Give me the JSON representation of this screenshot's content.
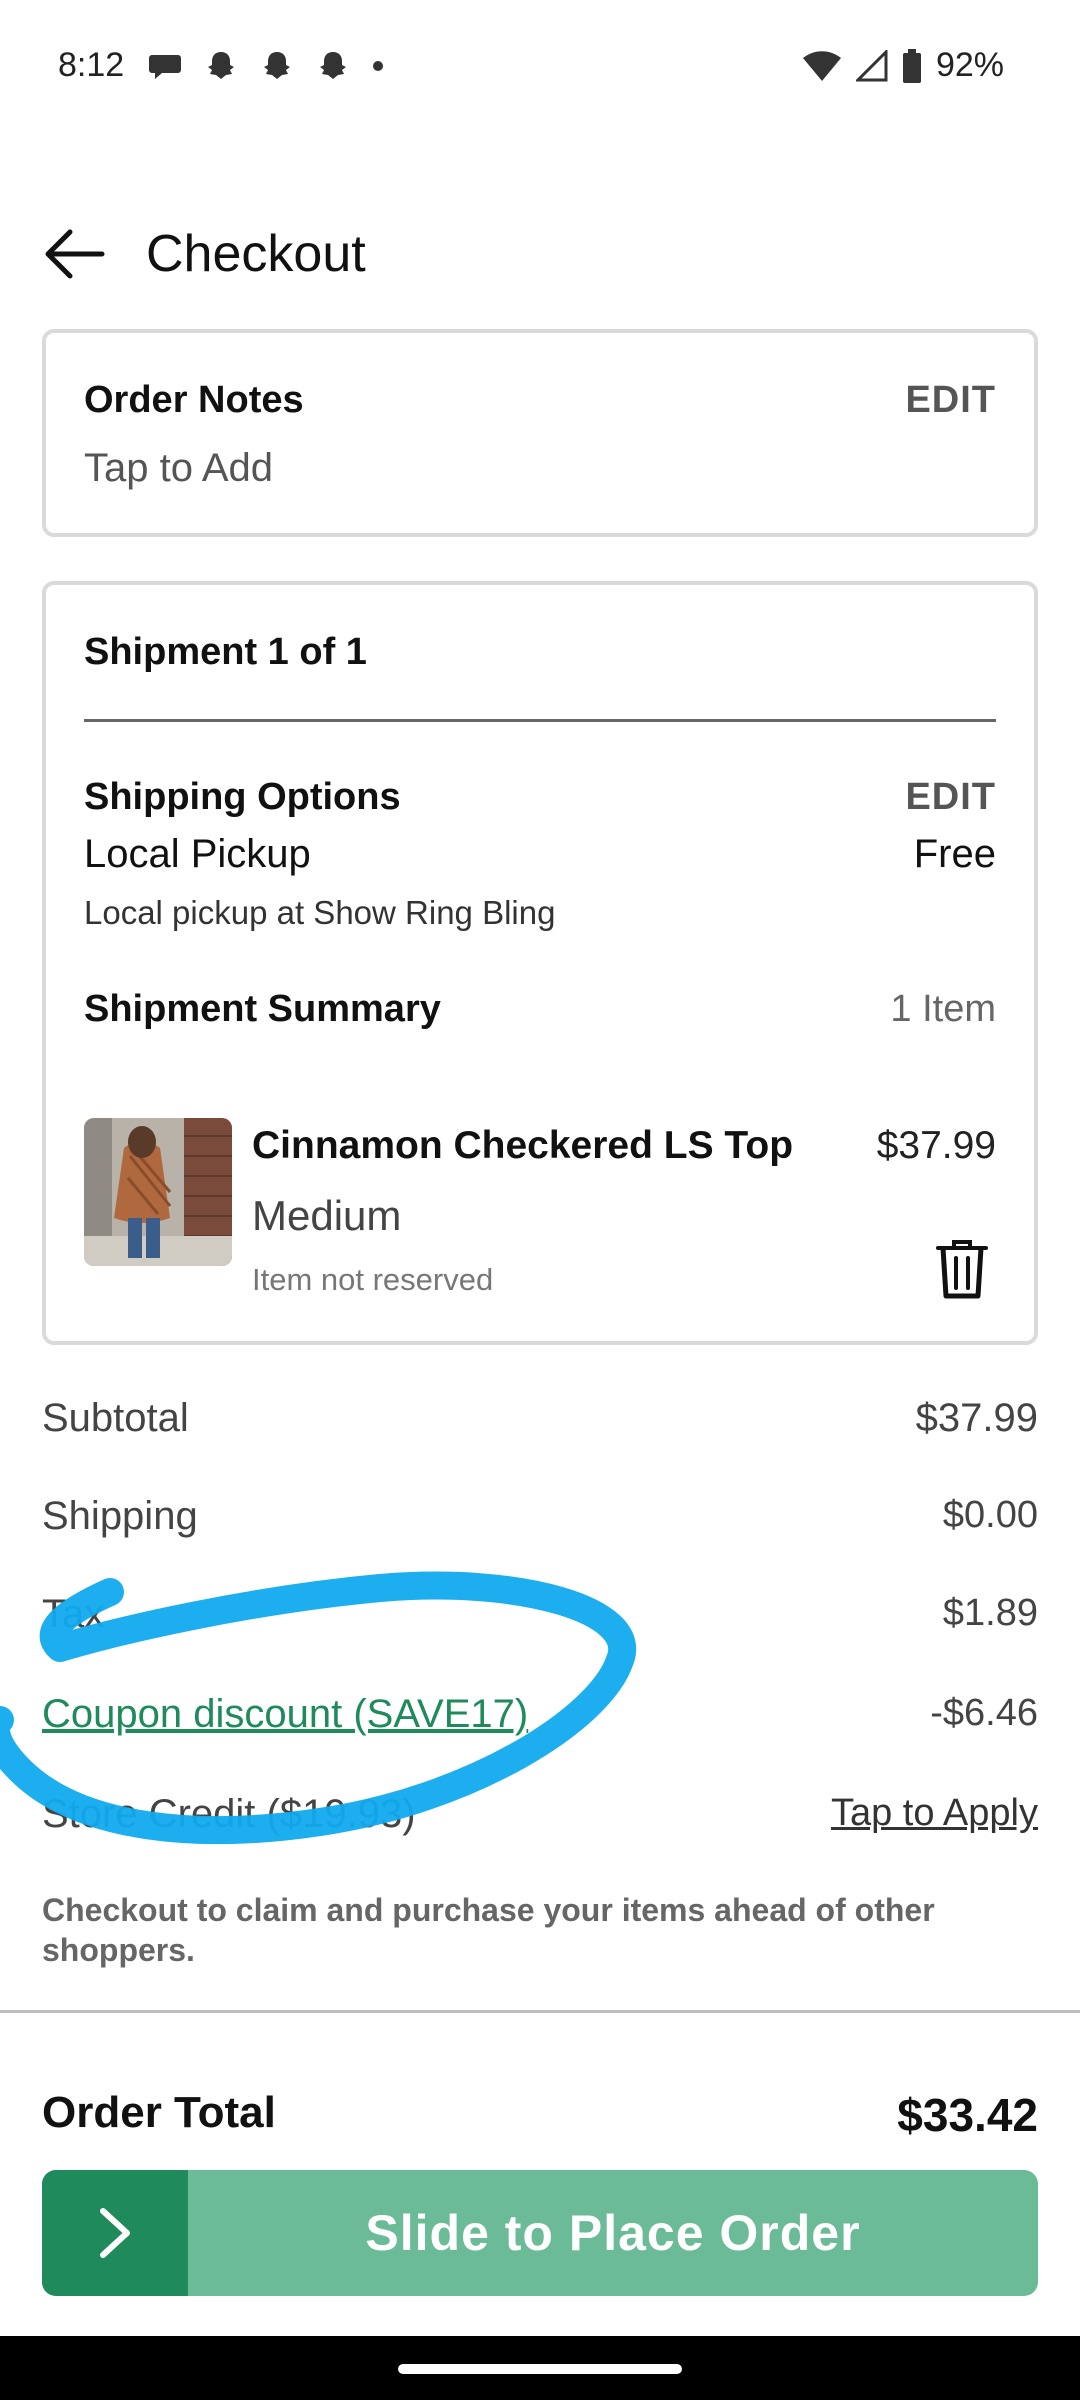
{
  "status_bar": {
    "time": "8:12",
    "notification_icons": [
      "message-icon",
      "snapchat-icon",
      "snapchat-icon",
      "snapchat-icon",
      "dot-icon"
    ],
    "battery": "92%"
  },
  "header": {
    "title": "Checkout"
  },
  "order_notes": {
    "title": "Order Notes",
    "edit": "EDIT",
    "placeholder": "Tap to Add"
  },
  "shipment": {
    "title": "Shipment 1 of 1",
    "shipping_options_label": "Shipping Options",
    "edit": "EDIT",
    "method": "Local Pickup",
    "method_price": "Free",
    "method_detail": "Local pickup at Show Ring Bling",
    "summary_label": "Shipment Summary",
    "item_count": "1 Item",
    "item": {
      "name": "Cinnamon Checkered LS Top",
      "price": "$37.99",
      "variant": "Medium",
      "reservation": "Item not reserved"
    }
  },
  "totals": {
    "subtotal_label": "Subtotal",
    "subtotal": "$37.99",
    "shipping_label": "Shipping",
    "shipping": "$0.00",
    "tax_label": "Tax",
    "tax": "$1.89",
    "coupon_label": "Coupon discount (SAVE17)",
    "coupon": "-$6.46",
    "store_credit_label": "Store Credit ($19.93)",
    "store_credit_action": "Tap to Apply"
  },
  "notice": "Checkout to claim and purchase your items ahead of other shoppers.",
  "order_total": {
    "label": "Order Total",
    "value": "$33.42"
  },
  "slider": {
    "label": "Slide to Place Order"
  },
  "colors": {
    "accent": "#1f8a5b",
    "slider_bg": "#6bbb98",
    "annotation": "#10aaee"
  }
}
